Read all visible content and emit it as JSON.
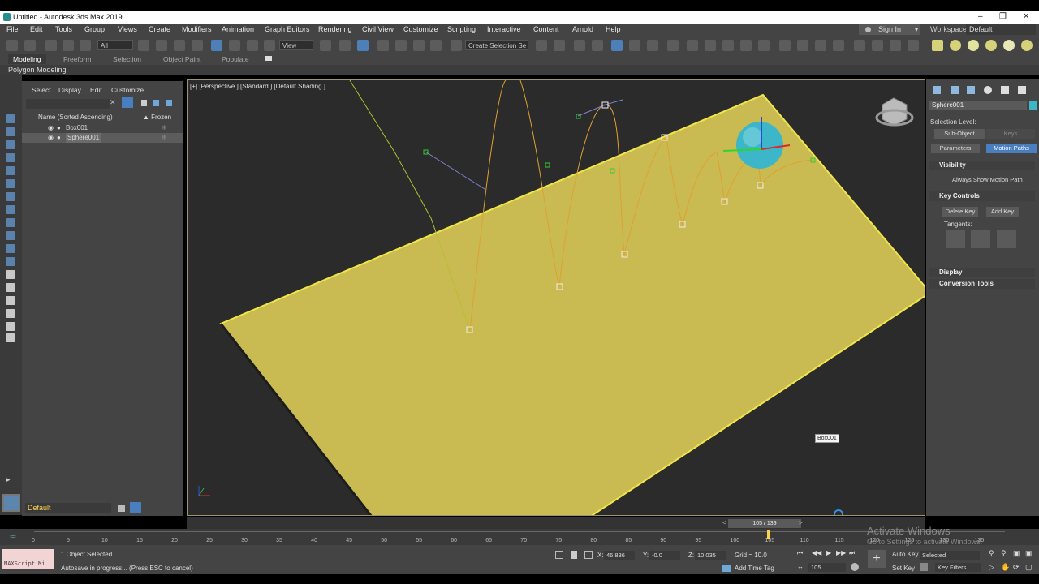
{
  "window": {
    "title": "Untitled - Autodesk 3ds Max 2019"
  },
  "menu": {
    "items": [
      "File",
      "Edit",
      "Tools",
      "Group",
      "Views",
      "Create",
      "Modifiers",
      "Animation",
      "Graph Editors",
      "Rendering",
      "Civil View",
      "Customize",
      "Scripting",
      "Interactive",
      "Content",
      "Arnold",
      "Help"
    ],
    "sign_in": "Sign In",
    "workspace_label": "Workspaces:",
    "workspace_value": "Default"
  },
  "toolbar": {
    "selection_filter": "All",
    "ref_coord": "View",
    "named_selection": "Create Selection Se"
  },
  "ribbon": {
    "tabs": [
      "Modeling",
      "Freeform",
      "Selection",
      "Object Paint",
      "Populate"
    ],
    "active_tab": "Modeling",
    "sub_label": "Polygon Modeling"
  },
  "scene_explorer": {
    "menus": [
      "Select",
      "Display",
      "Edit",
      "Customize"
    ],
    "col_name": "Name (Sorted Ascending)",
    "col_frozen": "▲ Frozen",
    "rows": [
      {
        "name": "Box001",
        "selected": false
      },
      {
        "name": "Sphere001",
        "selected": true
      }
    ],
    "layer": "Default"
  },
  "viewport": {
    "label": "[+] [Perspective ] [Standard ] [Default Shading ]",
    "tooltip": "Box001",
    "plane_color": "#c9bb52",
    "sphere_color": "#3cb6c8"
  },
  "command_panel": {
    "object_name": "Sphere001",
    "selection_level": "Selection Level:",
    "sub_object": "Sub-Object",
    "keys": "Keys",
    "parameters": "Parameters",
    "motion_paths": "Motion Paths",
    "visibility": "Visibility",
    "always_show": "Always Show Motion Path",
    "key_controls": "Key Controls",
    "delete_key": "Delete Key",
    "add_key": "Add Key",
    "tangents": "Tangents:",
    "display": "Display",
    "conversion_tools": "Conversion Tools"
  },
  "timeline": {
    "slider": "105 / 139",
    "current_frame": 105,
    "total": 139,
    "ticks": [
      "0",
      "5",
      "10",
      "15",
      "20",
      "25",
      "30",
      "35",
      "40",
      "45",
      "50",
      "55",
      "60",
      "65",
      "70",
      "75",
      "80",
      "85",
      "90",
      "95",
      "100",
      "105",
      "110",
      "115",
      "120",
      "125",
      "130",
      "135"
    ]
  },
  "status": {
    "maxscript": "MAXScript Mi",
    "selected": "1 Object Selected",
    "prompt": "Autosave in progress... (Press ESC to cancel)",
    "x_label": "X:",
    "x_value": "46.836",
    "y_label": "Y:",
    "y_value": "-0.0",
    "z_label": "Z:",
    "z_value": "10.035",
    "grid": "Grid = 10.0",
    "add_time_tag": "Add Time Tag",
    "auto_key": "Auto Key",
    "auto_key_mode": "Selected",
    "set_key": "Set Key",
    "key_filters": "Key Filters...",
    "frame": "105"
  },
  "watermark": {
    "line1": "Activate Windows",
    "line2": "Go to Settings to activate Windows."
  }
}
